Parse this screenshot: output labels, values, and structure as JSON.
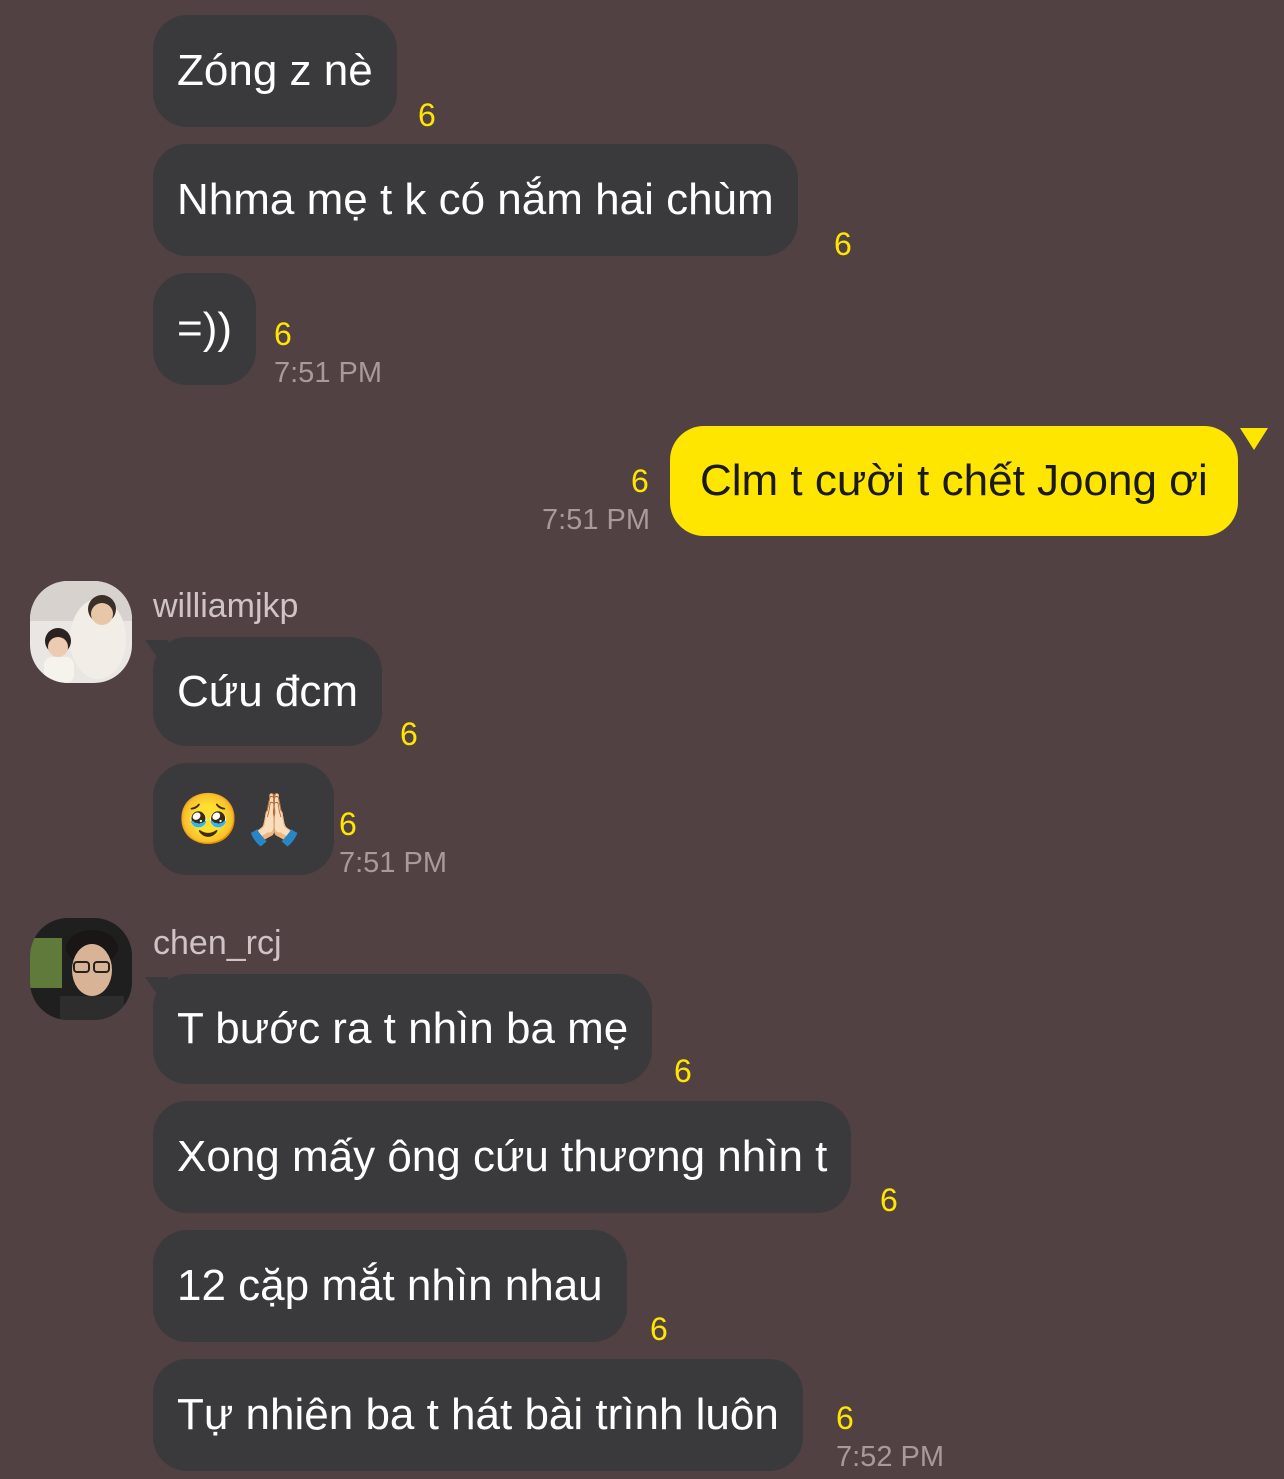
{
  "messages": [
    {
      "text": "Zóng z nè",
      "unread": "6"
    },
    {
      "text": "Nhma mẹ t k có nắm hai chùm",
      "unread": "6"
    },
    {
      "text": "=))",
      "unread": "6",
      "time": "7:51 PM"
    },
    {
      "text": "Clm t cười t chết Joong ơi",
      "unread": "6",
      "time": "7:51 PM"
    },
    {
      "sender": "williamjkp",
      "text": "Cứu đcm",
      "unread": "6"
    },
    {
      "text": "🥹🙏🏻",
      "unread": "6",
      "time": "7:51 PM"
    },
    {
      "sender": "chen_rcj",
      "text": "T bước ra t nhìn ba mẹ",
      "unread": "6"
    },
    {
      "text": "Xong mấy ông cứu thương nhìn t",
      "unread": "6"
    },
    {
      "text": "12 cặp mắt nhìn nhau",
      "unread": "6"
    },
    {
      "text": "Tự nhiên ba t hát bài trình luôn",
      "unread": "6",
      "time": "7:52 PM"
    }
  ],
  "colors": {
    "background": "#524143",
    "incoming_bubble": "#3a3a3c",
    "outgoing_bubble": "#ffe600",
    "unread_count": "#ffe600"
  }
}
